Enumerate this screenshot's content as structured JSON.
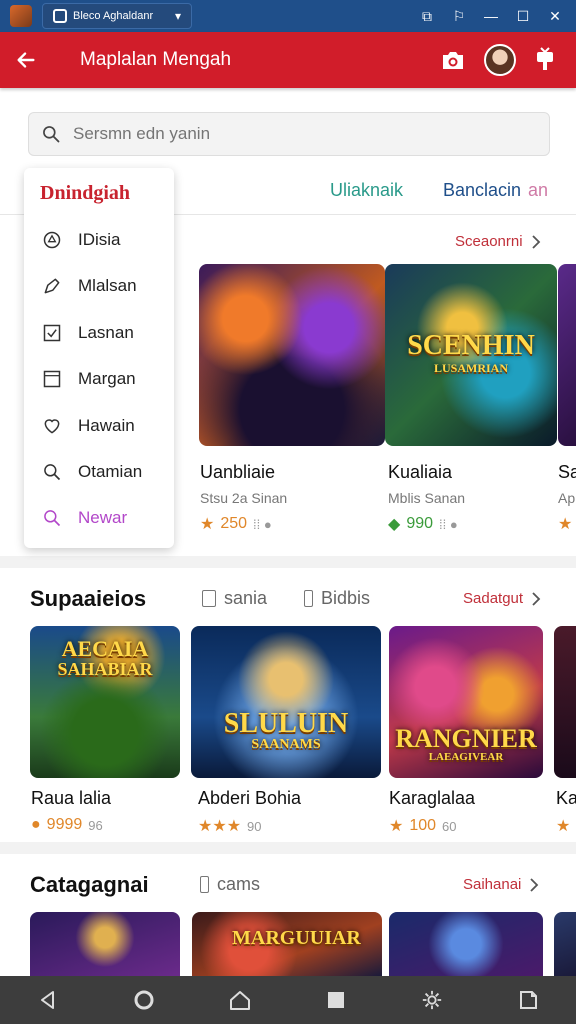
{
  "window": {
    "tab_title": "Bleco Aghaldanr",
    "menu_glyph": "▾",
    "controls": [
      "⧉",
      "⚐",
      "—",
      "☐",
      "✕"
    ]
  },
  "appbar": {
    "title": "Maplalan Mengah",
    "icons": [
      "arrow-left-icon",
      "camera-icon",
      "avatar",
      "gift-icon"
    ]
  },
  "search": {
    "placeholder": "Sersmn edn yanin"
  },
  "tabs": [
    {
      "label": "Dnindgiah",
      "color": "#c8232f"
    },
    {
      "label": "Uliaknaik",
      "color": "#2a9a8a"
    },
    {
      "label": "Banclacin",
      "color": "#1f4f8a"
    },
    {
      "label": "an",
      "color": "#cf7aa6"
    }
  ],
  "menu": {
    "title": "Dnindgiah",
    "items": [
      {
        "label": "IDisia",
        "icon": "compass-icon"
      },
      {
        "label": "Mlalsan",
        "icon": "pen-icon"
      },
      {
        "label": "Lasnan",
        "icon": "checkbox-icon"
      },
      {
        "label": "Margan",
        "icon": "square-icon"
      },
      {
        "label": "Hawain",
        "icon": "heart-icon"
      },
      {
        "label": "Otamian",
        "icon": "search-icon"
      },
      {
        "label": "Newar",
        "icon": "search-plus-icon"
      }
    ]
  },
  "featured": {
    "link": "Sceaonrni",
    "cards": [
      {
        "art_title": "SCENHIN",
        "art_sub": "LUSAMRIAN",
        "title": "Uanbliaie",
        "sub": "Stsu 2a Sinan",
        "rating": "250",
        "rating_color": "#e0872a",
        "trail": "⁞⁞ ●"
      },
      {
        "art_title": "",
        "art_sub": "",
        "title": "Kualiaia",
        "sub": "Mblis Sanan",
        "rating": "990",
        "rating_color": "#3a9b3a",
        "trail": "⁞⁞ ●"
      },
      {
        "art_title": "",
        "art_sub": "",
        "title": "Sa",
        "sub": "Ap",
        "rating": "",
        "rating_color": "#e0872a",
        "trail": ""
      }
    ]
  },
  "section2": {
    "title": "Supaaieios",
    "chips": [
      "sania",
      "Bidbis"
    ],
    "link": "Sadatgut",
    "cards": [
      {
        "art_title": "AECAIA",
        "art_sub": "SAHABIAR",
        "title": "Raua lalia",
        "rating": "9999",
        "rating_color": "#e0872a",
        "trail": "96"
      },
      {
        "art_title": "SLULUIN",
        "art_sub": "SAANAMS",
        "title": "Abderi Bohia",
        "rating": "★★★",
        "rating_color": "#e0872a",
        "trail": "90"
      },
      {
        "art_title": "RANGNIER",
        "art_sub": "LAEAGIVEAR",
        "title": "Karaglalaa",
        "rating": "100",
        "rating_color": "#e0872a",
        "trail": "60"
      },
      {
        "art_title": "",
        "art_sub": "",
        "title": "Ka",
        "rating": "",
        "rating_color": "#e0872a",
        "trail": ""
      }
    ]
  },
  "section3": {
    "title": "Catagagnai",
    "chips": [
      "cams"
    ],
    "link": "Saihanai",
    "cards": [
      {
        "art_title": "",
        "art_sub": ""
      },
      {
        "art_title": "MARGUUIAR",
        "art_sub": ""
      },
      {
        "art_title": "",
        "art_sub": ""
      },
      {
        "art_title": "",
        "art_sub": ""
      }
    ]
  },
  "navbar": {
    "icons": [
      "back-triangle-icon",
      "home-circle-icon",
      "home-icon",
      "recents-square-icon",
      "settings-icon",
      "screenshot-icon"
    ]
  }
}
